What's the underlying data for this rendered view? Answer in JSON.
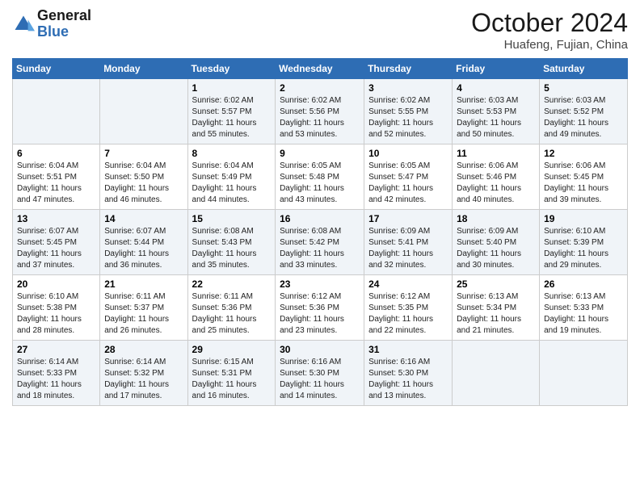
{
  "header": {
    "logo_general": "General",
    "logo_blue": "Blue",
    "month": "October 2024",
    "location": "Huafeng, Fujian, China"
  },
  "days_of_week": [
    "Sunday",
    "Monday",
    "Tuesday",
    "Wednesday",
    "Thursday",
    "Friday",
    "Saturday"
  ],
  "weeks": [
    [
      {
        "day": "",
        "info": ""
      },
      {
        "day": "",
        "info": ""
      },
      {
        "day": "1",
        "info": "Sunrise: 6:02 AM\nSunset: 5:57 PM\nDaylight: 11 hours\nand 55 minutes."
      },
      {
        "day": "2",
        "info": "Sunrise: 6:02 AM\nSunset: 5:56 PM\nDaylight: 11 hours\nand 53 minutes."
      },
      {
        "day": "3",
        "info": "Sunrise: 6:02 AM\nSunset: 5:55 PM\nDaylight: 11 hours\nand 52 minutes."
      },
      {
        "day": "4",
        "info": "Sunrise: 6:03 AM\nSunset: 5:53 PM\nDaylight: 11 hours\nand 50 minutes."
      },
      {
        "day": "5",
        "info": "Sunrise: 6:03 AM\nSunset: 5:52 PM\nDaylight: 11 hours\nand 49 minutes."
      }
    ],
    [
      {
        "day": "6",
        "info": "Sunrise: 6:04 AM\nSunset: 5:51 PM\nDaylight: 11 hours\nand 47 minutes."
      },
      {
        "day": "7",
        "info": "Sunrise: 6:04 AM\nSunset: 5:50 PM\nDaylight: 11 hours\nand 46 minutes."
      },
      {
        "day": "8",
        "info": "Sunrise: 6:04 AM\nSunset: 5:49 PM\nDaylight: 11 hours\nand 44 minutes."
      },
      {
        "day": "9",
        "info": "Sunrise: 6:05 AM\nSunset: 5:48 PM\nDaylight: 11 hours\nand 43 minutes."
      },
      {
        "day": "10",
        "info": "Sunrise: 6:05 AM\nSunset: 5:47 PM\nDaylight: 11 hours\nand 42 minutes."
      },
      {
        "day": "11",
        "info": "Sunrise: 6:06 AM\nSunset: 5:46 PM\nDaylight: 11 hours\nand 40 minutes."
      },
      {
        "day": "12",
        "info": "Sunrise: 6:06 AM\nSunset: 5:45 PM\nDaylight: 11 hours\nand 39 minutes."
      }
    ],
    [
      {
        "day": "13",
        "info": "Sunrise: 6:07 AM\nSunset: 5:45 PM\nDaylight: 11 hours\nand 37 minutes."
      },
      {
        "day": "14",
        "info": "Sunrise: 6:07 AM\nSunset: 5:44 PM\nDaylight: 11 hours\nand 36 minutes."
      },
      {
        "day": "15",
        "info": "Sunrise: 6:08 AM\nSunset: 5:43 PM\nDaylight: 11 hours\nand 35 minutes."
      },
      {
        "day": "16",
        "info": "Sunrise: 6:08 AM\nSunset: 5:42 PM\nDaylight: 11 hours\nand 33 minutes."
      },
      {
        "day": "17",
        "info": "Sunrise: 6:09 AM\nSunset: 5:41 PM\nDaylight: 11 hours\nand 32 minutes."
      },
      {
        "day": "18",
        "info": "Sunrise: 6:09 AM\nSunset: 5:40 PM\nDaylight: 11 hours\nand 30 minutes."
      },
      {
        "day": "19",
        "info": "Sunrise: 6:10 AM\nSunset: 5:39 PM\nDaylight: 11 hours\nand 29 minutes."
      }
    ],
    [
      {
        "day": "20",
        "info": "Sunrise: 6:10 AM\nSunset: 5:38 PM\nDaylight: 11 hours\nand 28 minutes."
      },
      {
        "day": "21",
        "info": "Sunrise: 6:11 AM\nSunset: 5:37 PM\nDaylight: 11 hours\nand 26 minutes."
      },
      {
        "day": "22",
        "info": "Sunrise: 6:11 AM\nSunset: 5:36 PM\nDaylight: 11 hours\nand 25 minutes."
      },
      {
        "day": "23",
        "info": "Sunrise: 6:12 AM\nSunset: 5:36 PM\nDaylight: 11 hours\nand 23 minutes."
      },
      {
        "day": "24",
        "info": "Sunrise: 6:12 AM\nSunset: 5:35 PM\nDaylight: 11 hours\nand 22 minutes."
      },
      {
        "day": "25",
        "info": "Sunrise: 6:13 AM\nSunset: 5:34 PM\nDaylight: 11 hours\nand 21 minutes."
      },
      {
        "day": "26",
        "info": "Sunrise: 6:13 AM\nSunset: 5:33 PM\nDaylight: 11 hours\nand 19 minutes."
      }
    ],
    [
      {
        "day": "27",
        "info": "Sunrise: 6:14 AM\nSunset: 5:33 PM\nDaylight: 11 hours\nand 18 minutes."
      },
      {
        "day": "28",
        "info": "Sunrise: 6:14 AM\nSunset: 5:32 PM\nDaylight: 11 hours\nand 17 minutes."
      },
      {
        "day": "29",
        "info": "Sunrise: 6:15 AM\nSunset: 5:31 PM\nDaylight: 11 hours\nand 16 minutes."
      },
      {
        "day": "30",
        "info": "Sunrise: 6:16 AM\nSunset: 5:30 PM\nDaylight: 11 hours\nand 14 minutes."
      },
      {
        "day": "31",
        "info": "Sunrise: 6:16 AM\nSunset: 5:30 PM\nDaylight: 11 hours\nand 13 minutes."
      },
      {
        "day": "",
        "info": ""
      },
      {
        "day": "",
        "info": ""
      }
    ]
  ]
}
